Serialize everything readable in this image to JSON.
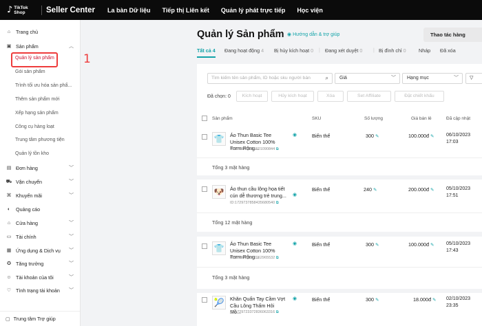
{
  "topbar": {
    "logo_line1": "TikTok",
    "logo_line2": "Shop",
    "app_title": "Seller Center",
    "nav": [
      "La bàn Dữ liệu",
      "Tiếp thị Liên kết",
      "Quản lý phát trực tiếp",
      "Học viện"
    ]
  },
  "sidebar": {
    "home": "Trang chủ",
    "products": "Sản phẩm",
    "product_sub": [
      "Quản lý sản phẩm",
      "Gói sản phẩm",
      "Trình tối ưu hóa sản phẩ...",
      "Thêm sản phẩm mới",
      "Xếp hạng sản phẩm",
      "Công cụ hàng loạt",
      "Trung tâm phương tiện",
      "Quản lý tồn kho"
    ],
    "sections": [
      "Đơn hàng",
      "Vận chuyển",
      "Khuyến mãi",
      "Quảng cáo",
      "Cửa hàng",
      "Tài chính",
      "Ứng dụng & Dịch vụ",
      "Tăng trưởng",
      "Tài khoản của tôi",
      "Tình trạng tài khoản"
    ],
    "chat": "Trung tâm Trợ giúp"
  },
  "annotation": {
    "number": "1"
  },
  "main": {
    "title": "Quản lý Sản phẩm",
    "help": "Hướng dẫn & trợ giúp",
    "action_button": "Thao tác hàng",
    "tabs": [
      {
        "label": "Tất cả",
        "count": "4"
      },
      {
        "label": "Đang hoạt động",
        "count": "4"
      },
      {
        "label": "Bị hủy kích hoạt",
        "count": "0"
      },
      {
        "label": "Đang xét duyệt",
        "count": "0"
      },
      {
        "label": "Bị đình chỉ",
        "count": "0"
      },
      {
        "label": "Nháp",
        "count": ""
      },
      {
        "label": "Đã xóa",
        "count": ""
      }
    ],
    "search_placeholder": "Tìm kiếm tên sản phẩm, ID hoặc sku người bán",
    "price_select": "Giá",
    "category_select": "Hạng mục",
    "selected_label": "Đã chọn: 0",
    "bulk_actions": [
      "Kích hoạt",
      "Hủy kích hoạt",
      "Xóa",
      "Set Affiliate",
      "Đặt chiết khấu"
    ],
    "columns": [
      "Sản phẩm",
      "SKU",
      "Số lượng",
      "Giá bán lẻ",
      "Đã cập nhật"
    ],
    "rows": [
      {
        "name": "Áo Thun Basic Tee Unisex Cotton 100% Form Rộng...",
        "id": "ID:1729738659601090844",
        "sku": "Biến thể",
        "qty": "300",
        "price": "100.000đ",
        "date": "06/10/2023",
        "time": "17:03",
        "total": "Tổng 3 mặt hàng",
        "thumb": "tshirt-white"
      },
      {
        "name": "Áo thun cầu lông họa tiết cún dễ thương trẻ trung...",
        "id": "ID:1729737858435680540",
        "sku": "Biến thể",
        "qty": "240",
        "price": "200.000đ",
        "date": "05/10/2023",
        "time": "17:51",
        "total": "Tổng 12 mặt hàng",
        "thumb": "tshirt-print"
      },
      {
        "name": "Áo Thun Basic Tee Unisex Cotton 100% Form Rộng...",
        "id": "ID:1729738317062965532",
        "sku": "Biến thể",
        "qty": "300",
        "price": "100.000đ",
        "date": "05/10/2023",
        "time": "17:43",
        "total": "Tổng 3 mặt hàng",
        "thumb": "tshirt-white"
      },
      {
        "name": "Khăn Quấn Tay Cầm Vợt Cầu Lông Thấm Hôi Mồ...",
        "id": "ID:1729723372836063316",
        "sku": "Biến thể",
        "qty": "300",
        "price": "18.000đ",
        "date": "02/10/2023",
        "time": "23:35",
        "total": "",
        "thumb": "grip-tape"
      }
    ]
  }
}
